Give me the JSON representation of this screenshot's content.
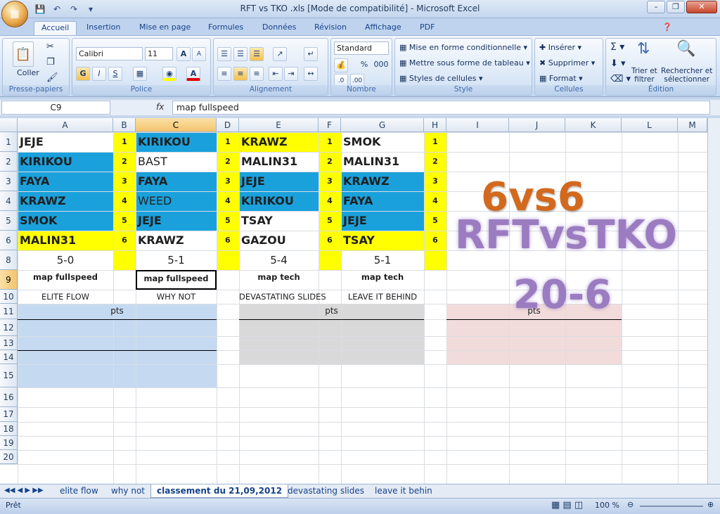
{
  "window": {
    "title": "RFT vs TKO .xls  [Mode de compatibilité] - Microsoft Excel"
  },
  "ribbon_tabs": [
    "Accueil",
    "Insertion",
    "Mise en page",
    "Formules",
    "Données",
    "Révision",
    "Affichage",
    "PDF"
  ],
  "groups": {
    "clipboard": {
      "label": "Presse-papiers",
      "paste": "Coller"
    },
    "font": {
      "label": "Police",
      "font_name": "Calibri",
      "font_size": "11"
    },
    "alignment": {
      "label": "Alignement"
    },
    "number": {
      "label": "Nombre",
      "format": "Standard",
      "percent": "%",
      "thousands": "000"
    },
    "style": {
      "label": "Style",
      "cond_format": "Mise en forme conditionnelle",
      "table_format": "Mettre sous forme de tableau",
      "cell_styles": "Styles de cellules"
    },
    "cells": {
      "label": "Cellules",
      "insert": "Insérer",
      "delete": "Supprimer",
      "format": "Format"
    },
    "editing": {
      "label": "Édition",
      "sort": "Trier et\nfiltrer",
      "find": "Rechercher et\nsélectionner"
    }
  },
  "formula_bar": {
    "name_box": "C9",
    "fx": "fx",
    "value": "map fullspeed"
  },
  "columns": [
    "A",
    "B",
    "C",
    "D",
    "E",
    "F",
    "G",
    "H",
    "I",
    "J",
    "K",
    "L",
    "M"
  ],
  "rows": [
    "1",
    "2",
    "3",
    "4",
    "5",
    "6",
    "8",
    "9",
    "10",
    "11",
    "12",
    "13",
    "14",
    "15",
    "16",
    "17",
    "18",
    "19",
    "20"
  ],
  "colors": {
    "blue": "#1aa1dc",
    "yellow": "#ffff00",
    "pts_blue": "#c5d9f1",
    "pts_gray": "#d9d9d9",
    "pts_pink": "#f2dcdb",
    "orange": "#d2691e",
    "purple": "#9b7cc0"
  },
  "blocks": [
    {
      "names": [
        "JEJE",
        "KIRIKOU",
        "FAYA",
        "KRAWZ",
        "SMOK",
        "MALIN31"
      ],
      "score": "5-0",
      "map": "map fullspeed",
      "song": "ELITE FLOW"
    },
    {
      "names": [
        "KIRIKOU",
        "BAST",
        "FAYA",
        "WEED",
        "JEJE",
        "KRAWZ"
      ],
      "score": "5-1",
      "map": "map fullspeed",
      "song": "WHY NOT"
    },
    {
      "names": [
        "KRAWZ",
        "MALIN31",
        "JEJE",
        "KIRIKOU",
        "TSAY",
        "GAZOU"
      ],
      "score": "5-4",
      "map": "map tech",
      "song": "DEVASTATING SLIDES"
    },
    {
      "names": [
        "SMOK",
        "MALIN31",
        "KRAWZ",
        "FAYA",
        "JEJE",
        "TSAY"
      ],
      "score": "5-1",
      "map": "map tech",
      "song": "LEAVE IT BEHIND"
    }
  ],
  "numbers": [
    "1",
    "2",
    "3",
    "4",
    "5",
    "6"
  ],
  "pts_label": "pts",
  "big_text": {
    "line1": "6vs6",
    "line2": "RFTvsTKO",
    "line3": "20-6"
  },
  "sheet_tabs": [
    "elite flow",
    "why not",
    "classement du 21,09,2012",
    "devastating slides",
    "leave it behin"
  ],
  "status": {
    "ready": "Prêt",
    "zoom": "100 %"
  }
}
